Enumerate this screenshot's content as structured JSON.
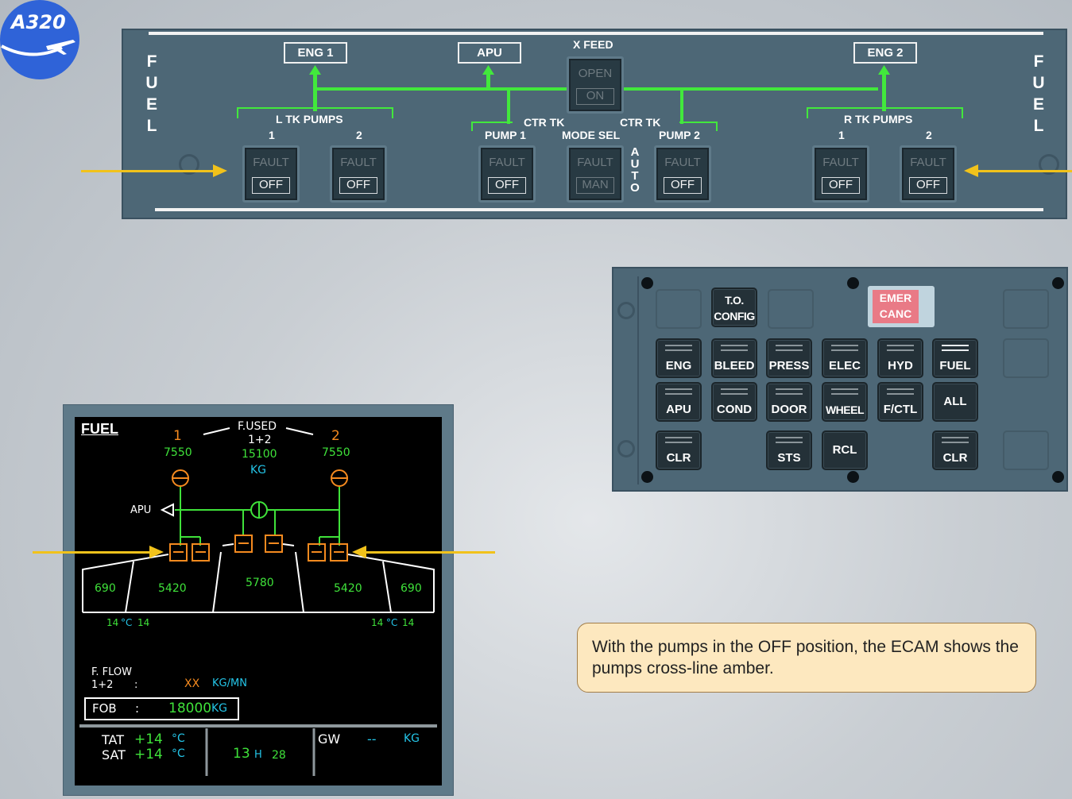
{
  "logo": {
    "text": "A320",
    "icon": "airplane-icon"
  },
  "overhead": {
    "side_label_left": [
      "F",
      "U",
      "E",
      "L"
    ],
    "side_label_right": [
      "F",
      "U",
      "E",
      "L"
    ],
    "eng1": "ENG 1",
    "apu": "APU",
    "xfeed_title": "X FEED",
    "xfeed_top": "OPEN",
    "xfeed_bottom": "ON",
    "eng2": "ENG 2",
    "l_tk_pumps": "L TK PUMPS",
    "r_tk_pumps": "R TK PUMPS",
    "num1": "1",
    "num2": "2",
    "ctr_tk_left": "CTR TK",
    "ctr_tk_right": "CTR TK",
    "pump1": "PUMP 1",
    "mode_sel": "MODE SEL",
    "pump2": "PUMP 2",
    "auto": [
      "A",
      "U",
      "T",
      "O"
    ],
    "pb_fault": "FAULT",
    "pb_off": "OFF",
    "pb_man": "MAN"
  },
  "ecp": {
    "to_config": [
      "T.O.",
      "CONFIG"
    ],
    "emer_canc": [
      "EMER",
      "CANC"
    ],
    "row1": [
      "ENG",
      "BLEED",
      "PRESS",
      "ELEC",
      "HYD",
      "FUEL"
    ],
    "row2": [
      "APU",
      "COND",
      "DOOR",
      "WHEEL",
      "F/CTL"
    ],
    "all": "ALL",
    "clr": "CLR",
    "sts": "STS",
    "rcl": "RCL",
    "lit_key": "FUEL"
  },
  "ecam": {
    "title": "FUEL",
    "fused_label": "F.USED",
    "fused_sub": "1+2",
    "eng1_num": "1",
    "eng2_num": "2",
    "eng1_used": "7550",
    "eng2_used": "7550",
    "total_used": "15100",
    "used_unit": "KG",
    "apu_label": "APU",
    "outer_left": "690",
    "inner_left": "5420",
    "center": "5780",
    "inner_right": "5420",
    "outer_right": "690",
    "temp_left_a": "14",
    "temp_unit": "°C",
    "temp_left_b": "14",
    "temp_right_a": "14",
    "temp_right_b": "14",
    "fflow_label": "F. FLOW",
    "fflow_sub": "1+2",
    "fflow_colon": ":",
    "fflow_value": "XX",
    "fflow_unit": "KG/MN",
    "fob_label": "FOB",
    "fob_colon": ":",
    "fob_value": "18000",
    "fob_unit": "KG",
    "tat_label": "TAT",
    "tat_value": "+14",
    "sat_label": "SAT",
    "sat_value": "+14",
    "deg_c": "°C",
    "time_h": "13",
    "time_h_unit": "H",
    "time_m": "28",
    "gw_label": "GW",
    "gw_value": "--",
    "gw_unit": "KG"
  },
  "info_text": "With the pumps in the OFF position, the ECAM shows the pumps cross-line amber.",
  "colors": {
    "panel": "#4d6776",
    "green_line": "#42e83c",
    "amber": "#f58a1f",
    "cyan": "#24c5e8",
    "arrow": "#f1c21b",
    "emer": "#e97a86"
  }
}
